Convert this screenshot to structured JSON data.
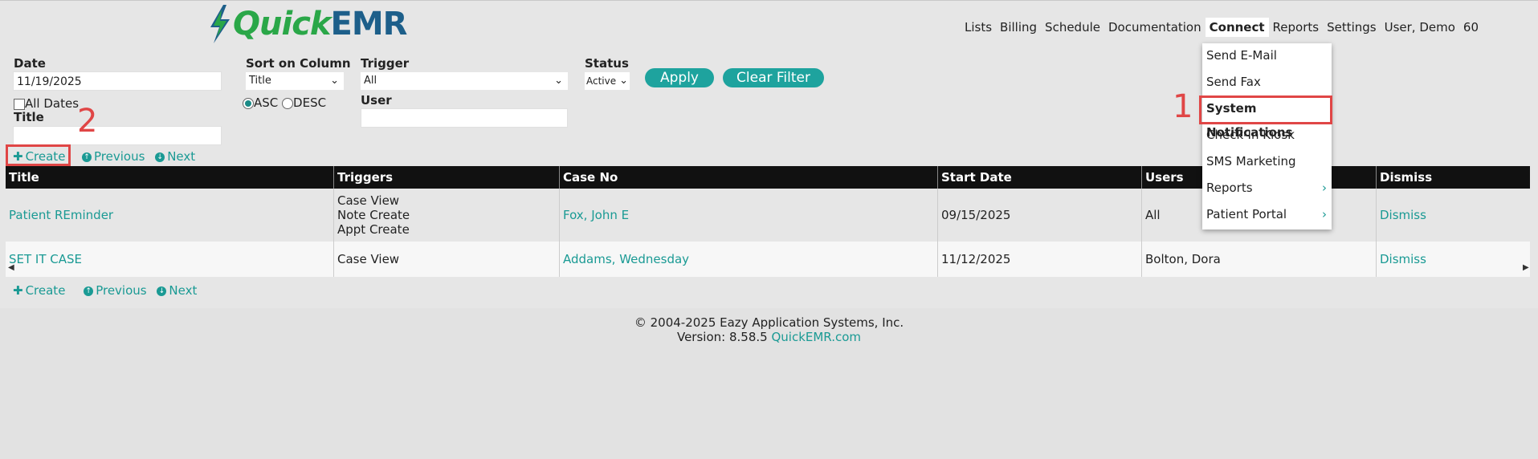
{
  "logo": {
    "quick": "Quick",
    "emr": "EMR"
  },
  "nav": {
    "items": [
      "Lists",
      "Billing",
      "Schedule",
      "Documentation",
      "Connect",
      "Reports",
      "Settings",
      "User, Demo",
      "60"
    ],
    "active": "Connect"
  },
  "filters": {
    "date_label": "Date",
    "date_value": "11/19/2025",
    "all_dates_label": "All Dates",
    "title_label": "Title",
    "title_value": "",
    "sort_label": "Sort on Column",
    "sort_value": "Title",
    "asc_label": "ASC",
    "desc_label": "DESC",
    "trigger_label": "Trigger",
    "trigger_value": "All",
    "user_label": "User",
    "user_value": "",
    "status_label": "Status",
    "status_value": "Active",
    "apply_label": "Apply",
    "clear_label": "Clear Filter"
  },
  "toolbar": {
    "create": "Create",
    "previous": "Previous",
    "next": "Next"
  },
  "table": {
    "headers": [
      "Title",
      "Triggers",
      "Case No",
      "Start Date",
      "Users",
      "Dismiss"
    ],
    "rows": [
      {
        "title": "Patient REminder",
        "triggers": [
          "Case View",
          "Note Create",
          "Appt Create"
        ],
        "case_no": "Fox, John E",
        "start_date": "09/15/2025",
        "users": "All",
        "dismiss": "Dismiss"
      },
      {
        "title": "SET IT CASE",
        "triggers": [
          "Case View"
        ],
        "case_no": "Addams, Wednesday",
        "start_date": "11/12/2025",
        "users": "Bolton, Dora",
        "dismiss": "Dismiss"
      }
    ]
  },
  "connect_menu": {
    "items": [
      {
        "label": "Send E-Mail",
        "submenu": false
      },
      {
        "label": "Send Fax",
        "submenu": false
      },
      {
        "label": "System Notifications",
        "submenu": false
      },
      {
        "label": "Check-In Kiosk",
        "submenu": false
      },
      {
        "label": "SMS Marketing",
        "submenu": false
      },
      {
        "label": "Reports",
        "submenu": true
      },
      {
        "label": "Patient Portal",
        "submenu": true
      }
    ]
  },
  "annotations": {
    "one": "1",
    "two": "2"
  },
  "footer": {
    "copyright": "© 2004-2025 Eazy Application Systems, Inc.",
    "version_prefix": "Version: 8.58.5",
    "link": "QuickEMR.com"
  },
  "colors": {
    "accent": "#1ea39e",
    "logo_green": "#2aa748",
    "logo_blue": "#1d5f8a",
    "highlight": "#e04646"
  }
}
